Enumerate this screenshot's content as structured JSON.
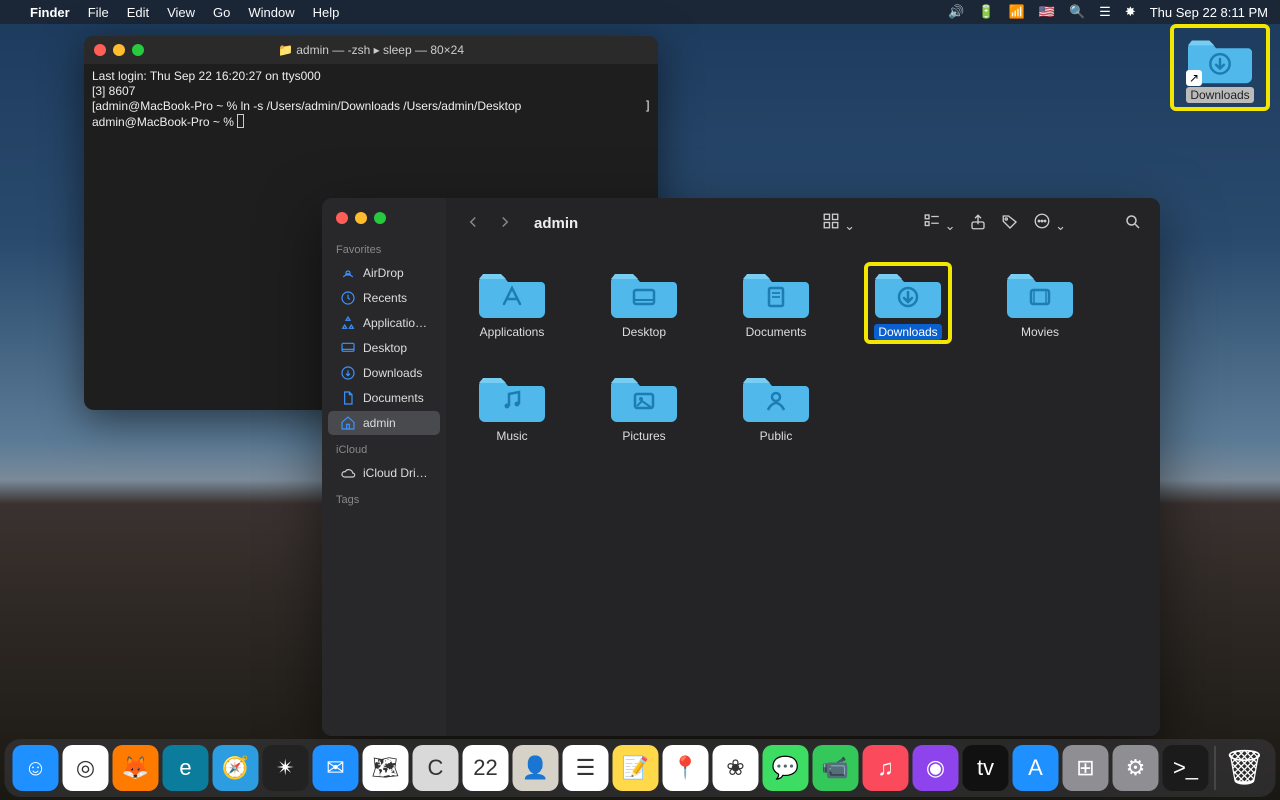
{
  "menubar": {
    "app": "Finder",
    "items": [
      "File",
      "Edit",
      "View",
      "Go",
      "Window",
      "Help"
    ],
    "datetime": "Thu Sep 22  8:11 PM"
  },
  "terminal": {
    "title": "admin — -zsh ▸ sleep — 80×24",
    "lines": [
      "Last login: Thu Sep 22 16:20:27 on ttys000",
      "[3] 8607",
      "[admin@MacBook-Pro ~ % ln -s /Users/admin/Downloads /Users/admin/Desktop",
      "admin@MacBook-Pro ~ % "
    ]
  },
  "finder": {
    "title": "admin",
    "sidebar": {
      "favorites_heading": "Favorites",
      "items": [
        {
          "label": "AirDrop",
          "icon": "airdrop"
        },
        {
          "label": "Recents",
          "icon": "clock"
        },
        {
          "label": "Applicatio…",
          "icon": "apps"
        },
        {
          "label": "Desktop",
          "icon": "desktop"
        },
        {
          "label": "Downloads",
          "icon": "download"
        },
        {
          "label": "Documents",
          "icon": "doc"
        },
        {
          "label": "admin",
          "icon": "home",
          "selected": true
        }
      ],
      "icloud_heading": "iCloud",
      "icloud_items": [
        {
          "label": "iCloud Dri…",
          "icon": "cloud"
        }
      ],
      "tags_heading": "Tags"
    },
    "folders": [
      {
        "label": "Applications",
        "glyph": "A"
      },
      {
        "label": "Desktop",
        "glyph": "▭"
      },
      {
        "label": "Documents",
        "glyph": "📄"
      },
      {
        "label": "Downloads",
        "glyph": "⬇",
        "selected": true,
        "highlight": true
      },
      {
        "label": "Movies",
        "glyph": "🎬"
      },
      {
        "label": "Music",
        "glyph": "♪"
      },
      {
        "label": "Pictures",
        "glyph": "🖼"
      },
      {
        "label": "Public",
        "glyph": "👤"
      }
    ]
  },
  "desktop_icon": {
    "label": "Downloads"
  },
  "dock": {
    "apps": [
      {
        "name": "finder",
        "color": "#1e90ff",
        "glyph": "☺"
      },
      {
        "name": "chrome",
        "color": "#fff",
        "glyph": "◎"
      },
      {
        "name": "firefox",
        "color": "#ff7b00",
        "glyph": "🦊"
      },
      {
        "name": "edge",
        "color": "#0b7c9c",
        "glyph": "e"
      },
      {
        "name": "safari",
        "color": "#2b9de0",
        "glyph": "🧭"
      },
      {
        "name": "siri",
        "color": "#222",
        "glyph": "✴"
      },
      {
        "name": "mail",
        "color": "#1f8fff",
        "glyph": "✉"
      },
      {
        "name": "maps",
        "color": "#fff",
        "glyph": "🗺"
      },
      {
        "name": "cursive",
        "color": "#d9d9d9",
        "glyph": "C"
      },
      {
        "name": "calendar",
        "color": "#fff",
        "glyph": "22"
      },
      {
        "name": "contacts",
        "color": "#d7d2c7",
        "glyph": "👤"
      },
      {
        "name": "reminders",
        "color": "#fff",
        "glyph": "☰"
      },
      {
        "name": "notes",
        "color": "#ffd94a",
        "glyph": "📝"
      },
      {
        "name": "maps2",
        "color": "#fff",
        "glyph": "📍"
      },
      {
        "name": "photos",
        "color": "#fff",
        "glyph": "❀"
      },
      {
        "name": "messages",
        "color": "#3ddc63",
        "glyph": "💬"
      },
      {
        "name": "facetime",
        "color": "#34c759",
        "glyph": "📹"
      },
      {
        "name": "music",
        "color": "#fa4a5b",
        "glyph": "♫"
      },
      {
        "name": "podcasts",
        "color": "#8e44ec",
        "glyph": "◉"
      },
      {
        "name": "tv",
        "color": "#111",
        "glyph": "tv"
      },
      {
        "name": "appstore",
        "color": "#1e90ff",
        "glyph": "A"
      },
      {
        "name": "launchpad",
        "color": "#8e8e93",
        "glyph": "⊞"
      },
      {
        "name": "settings",
        "color": "#8e8e93",
        "glyph": "⚙"
      },
      {
        "name": "terminal",
        "color": "#1b1b1b",
        "glyph": ">_"
      }
    ],
    "trash": {
      "name": "trash",
      "glyph": "🗑"
    }
  },
  "colors": {
    "folder": "#50b8ea",
    "folder_dark": "#2596cf"
  }
}
